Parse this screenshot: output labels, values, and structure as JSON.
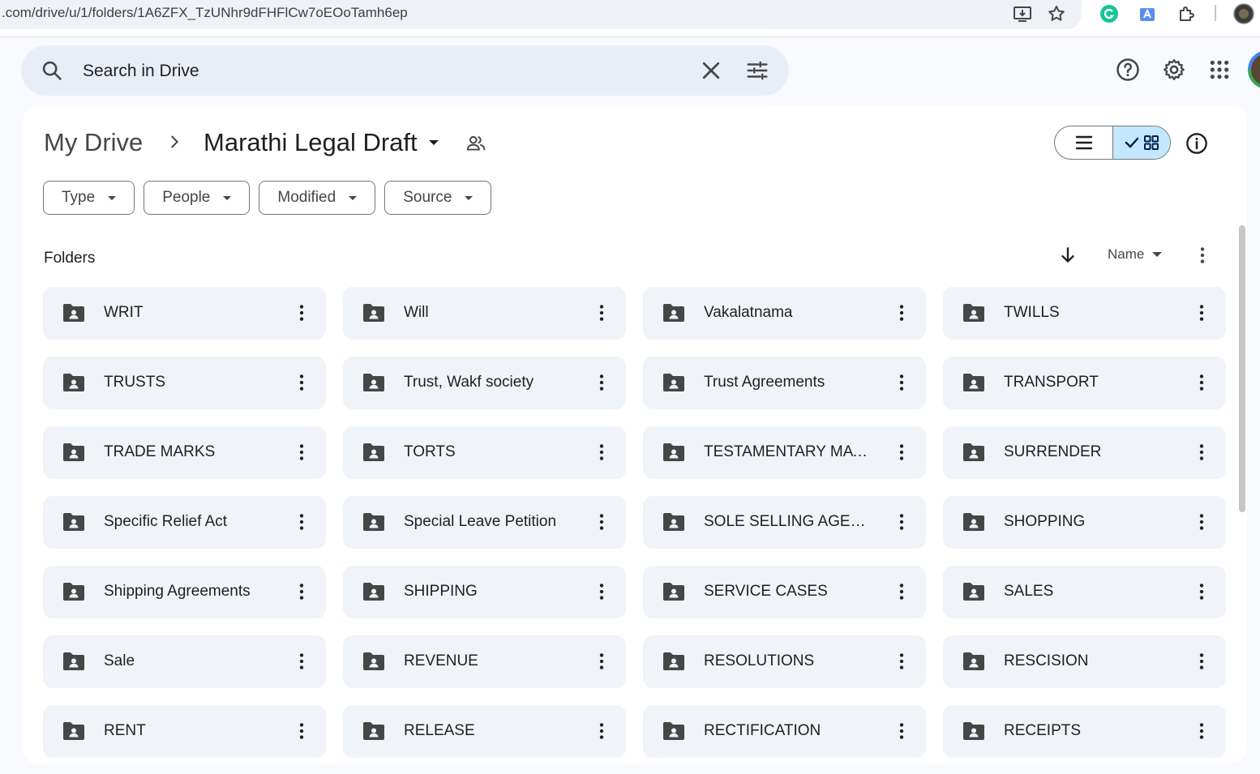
{
  "browser": {
    "url": ".com/drive/u/1/folders/1A6ZFX_TzUNhr9dFHFlCw7oEOoTamh6ep"
  },
  "search": {
    "placeholder": "Search in Drive"
  },
  "breadcrumb": {
    "root": "My Drive",
    "current": "Marathi Legal Draft"
  },
  "filters": [
    {
      "label": "Type"
    },
    {
      "label": "People"
    },
    {
      "label": "Modified"
    },
    {
      "label": "Source"
    }
  ],
  "section": {
    "title": "Folders",
    "sort_label": "Name"
  },
  "colors": {
    "accent": "#c2e7ff",
    "tile": "#f0f4f9",
    "search_bg": "#e9eef6"
  },
  "folders": [
    {
      "name": "WRIT"
    },
    {
      "name": "Will"
    },
    {
      "name": "Vakalatnama"
    },
    {
      "name": "TWILLS"
    },
    {
      "name": "TRUSTS"
    },
    {
      "name": "Trust, Wakf society"
    },
    {
      "name": "Trust Agreements"
    },
    {
      "name": "TRANSPORT"
    },
    {
      "name": "TRADE MARKS"
    },
    {
      "name": "TORTS"
    },
    {
      "name": "TESTAMENTARY MATT..."
    },
    {
      "name": "SURRENDER"
    },
    {
      "name": "Specific Relief Act"
    },
    {
      "name": "Special Leave Petition"
    },
    {
      "name": "SOLE SELLING AGENCY"
    },
    {
      "name": "SHOPPING"
    },
    {
      "name": "Shipping Agreements"
    },
    {
      "name": "SHIPPING"
    },
    {
      "name": "SERVICE CASES"
    },
    {
      "name": "SALES"
    },
    {
      "name": "Sale"
    },
    {
      "name": "REVENUE"
    },
    {
      "name": "RESOLUTIONS"
    },
    {
      "name": "RESCISION"
    },
    {
      "name": "RENT"
    },
    {
      "name": "RELEASE"
    },
    {
      "name": "RECTIFICATION"
    },
    {
      "name": "RECEIPTS"
    }
  ]
}
